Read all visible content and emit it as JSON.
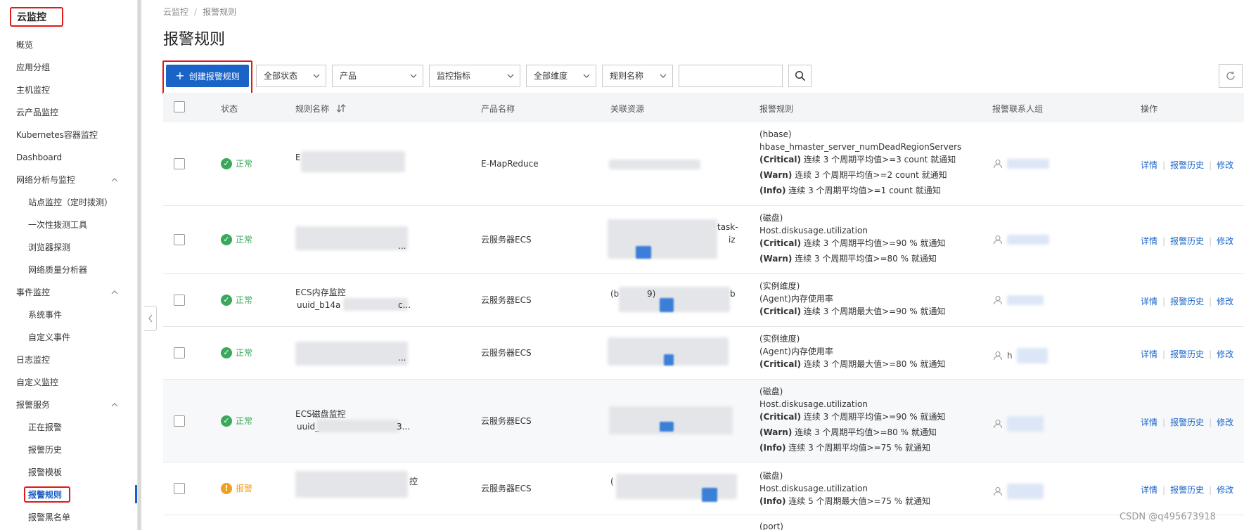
{
  "sidebar": {
    "title": "云监控",
    "items": [
      {
        "label": "概览",
        "expandable": false
      },
      {
        "label": "应用分组",
        "expandable": false
      },
      {
        "label": "主机监控",
        "expandable": false
      },
      {
        "label": "云产品监控",
        "expandable": false
      },
      {
        "label": "Kubernetes容器监控",
        "expandable": false
      },
      {
        "label": "Dashboard",
        "expandable": false
      },
      {
        "label": "网络分析与监控",
        "expandable": true
      },
      {
        "label": "站点监控（定时拨测）",
        "sub": true
      },
      {
        "label": "一次性拨测工具",
        "sub": true
      },
      {
        "label": "浏览器探测",
        "sub": true
      },
      {
        "label": "网络质量分析器",
        "sub": true
      },
      {
        "label": "事件监控",
        "expandable": true
      },
      {
        "label": "系统事件",
        "sub": true
      },
      {
        "label": "自定义事件",
        "sub": true
      },
      {
        "label": "日志监控",
        "expandable": false
      },
      {
        "label": "自定义监控",
        "expandable": false
      },
      {
        "label": "报警服务",
        "expandable": true
      },
      {
        "label": "正在报警",
        "sub": true
      },
      {
        "label": "报警历史",
        "sub": true
      },
      {
        "label": "报警模板",
        "sub": true
      },
      {
        "label": "报警规则",
        "sub": true,
        "active": true
      },
      {
        "label": "报警黑名单",
        "sub": true
      }
    ]
  },
  "breadcrumb": {
    "root": "云监控",
    "sep": "/",
    "current": "报警规则"
  },
  "page_title": "报警规则",
  "toolbar": {
    "create_label": "创建报警规则",
    "filters": [
      "全部状态",
      "产品",
      "监控指标",
      "全部维度",
      "规则名称"
    ],
    "search_value": ""
  },
  "table": {
    "headers": {
      "status": "状态",
      "name": "规则名称",
      "sort_icon": "sort-icon",
      "product": "产品名称",
      "resource": "关联资源",
      "rule": "报警规则",
      "contacts": "报警联系人组",
      "ops": "操作"
    },
    "ops_labels": {
      "detail": "详情",
      "history": "报警历史",
      "edit": "修改"
    },
    "rows": [
      {
        "status": "正常",
        "status_type": "ok",
        "name_line1": "E",
        "name_line2": "",
        "product": "E-MapReduce",
        "rules": [
          {
            "bold": "",
            "text": "(hbase)"
          },
          {
            "bold": "",
            "text": "hbase_hmaster_server_numDeadRegionServers"
          },
          {
            "bold": "(Critical)",
            "text": " 连续 3 个周期平均值>=3 count 就通知"
          },
          {
            "bold": "(Warn)",
            "text": " 连续 3 个周期平均值>=2 count 就通知"
          },
          {
            "bold": "(Info)",
            "text": " 连续 3 个周期平均值>=1 count 就通知"
          }
        ]
      },
      {
        "status": "正常",
        "status_type": "ok",
        "name_line1": "",
        "name_line2": "...",
        "product": "云服务器ECS",
        "resource_hint": "task-",
        "resource_hint2": "iz",
        "rules": [
          {
            "bold": "",
            "text": "(磁盘)"
          },
          {
            "bold": "",
            "text": "Host.diskusage.utilization"
          },
          {
            "bold": "(Critical)",
            "text": " 连续 3 个周期平均值>=90 % 就通知"
          },
          {
            "bold": "(Warn)",
            "text": " 连续 3 个周期平均值>=80 % 就通知"
          }
        ]
      },
      {
        "status": "正常",
        "status_type": "ok",
        "name_line1": "ECS内存监控",
        "name_line2": "uuid_b14a",
        "name_line2_tail": "c...",
        "product": "云服务器ECS",
        "resource_hint": "(b",
        "resource_hint2": "9)",
        "resource_hint3": "b",
        "rules": [
          {
            "bold": "",
            "text": "(实例维度)"
          },
          {
            "bold": "",
            "text": "(Agent)内存使用率"
          },
          {
            "bold": "(Critical)",
            "text": " 连续 3 个周期最大值>=90 % 就通知"
          }
        ]
      },
      {
        "status": "正常",
        "status_type": "ok",
        "name_line1": "",
        "name_line2": "...",
        "product": "云服务器ECS",
        "contact_hint": "h",
        "rules": [
          {
            "bold": "",
            "text": "(实例维度)"
          },
          {
            "bold": "",
            "text": "(Agent)内存使用率"
          },
          {
            "bold": "(Critical)",
            "text": " 连续 3 个周期最大值>=80 % 就通知"
          }
        ]
      },
      {
        "status": "正常",
        "status_type": "ok",
        "name_line1": "ECS磁盘监控",
        "name_line2": "uuid_",
        "name_line2_tail": "3...",
        "product": "云服务器ECS",
        "rules": [
          {
            "bold": "",
            "text": "(磁盘)"
          },
          {
            "bold": "",
            "text": "Host.diskusage.utilization"
          },
          {
            "bold": "(Critical)",
            "text": " 连续 3 个周期平均值>=90 % 就通知"
          },
          {
            "bold": "(Warn)",
            "text": " 连续 3 个周期平均值>=80 % 就通知"
          },
          {
            "bold": "(Info)",
            "text": " 连续 3 个周期平均值>=75 % 就通知"
          }
        ]
      },
      {
        "status": "报警",
        "status_type": "warn",
        "name_line1": "",
        "name_line1_tail": "控",
        "name_line2": "",
        "product": "云服务器ECS",
        "resource_hint": "(",
        "rules": [
          {
            "bold": "",
            "text": "(磁盘)"
          },
          {
            "bold": "",
            "text": "Host.diskusage.utilization"
          },
          {
            "bold": "(Info)",
            "text": " 连续 5 个周期最大值>=75 % 就通知"
          }
        ]
      },
      {
        "status": "",
        "status_type": "none",
        "name_line1": "",
        "name_line2": "",
        "product": "",
        "rules": [
          {
            "bold": "",
            "text": "(port)"
          }
        ]
      }
    ]
  },
  "watermark": "CSDN @q495673918",
  "colors": {
    "primary": "#1a64c8",
    "ok": "#3aa85b",
    "warn": "#f0a020",
    "highlight_box": "#e01919"
  }
}
